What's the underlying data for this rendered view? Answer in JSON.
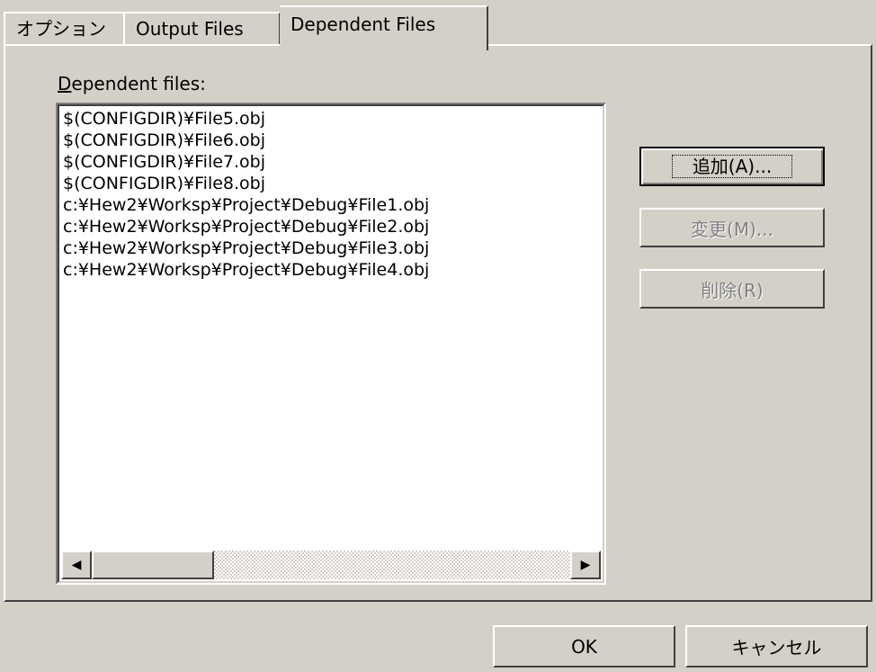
{
  "tabs": [
    {
      "label": "オプション"
    },
    {
      "label": "Output Files"
    },
    {
      "label": "Dependent Files"
    }
  ],
  "panel": {
    "list_label_accesskey": "D",
    "list_label_rest": "ependent files:",
    "files": [
      "$(CONFIGDIR)¥File5.obj",
      "$(CONFIGDIR)¥File6.obj",
      "$(CONFIGDIR)¥File7.obj",
      "$(CONFIGDIR)¥File8.obj",
      "c:¥Hew2¥Worksp¥Project¥Debug¥File1.obj",
      "c:¥Hew2¥Worksp¥Project¥Debug¥File2.obj",
      "c:¥Hew2¥Worksp¥Project¥Debug¥File3.obj",
      "c:¥Hew2¥Worksp¥Project¥Debug¥File4.obj"
    ],
    "scroll_left_glyph": "◀",
    "scroll_right_glyph": "▶",
    "add_label": "追加(A)...",
    "change_label": "変更(M)...",
    "delete_label": "削除(R)"
  },
  "footer": {
    "ok_label": "OK",
    "cancel_label": "キャンセル"
  },
  "colors": {
    "face": "#d4d0c8",
    "highlight": "#ffffff",
    "shadow": "#808080",
    "dark_shadow": "#404040",
    "disabled_text": "#808080"
  }
}
